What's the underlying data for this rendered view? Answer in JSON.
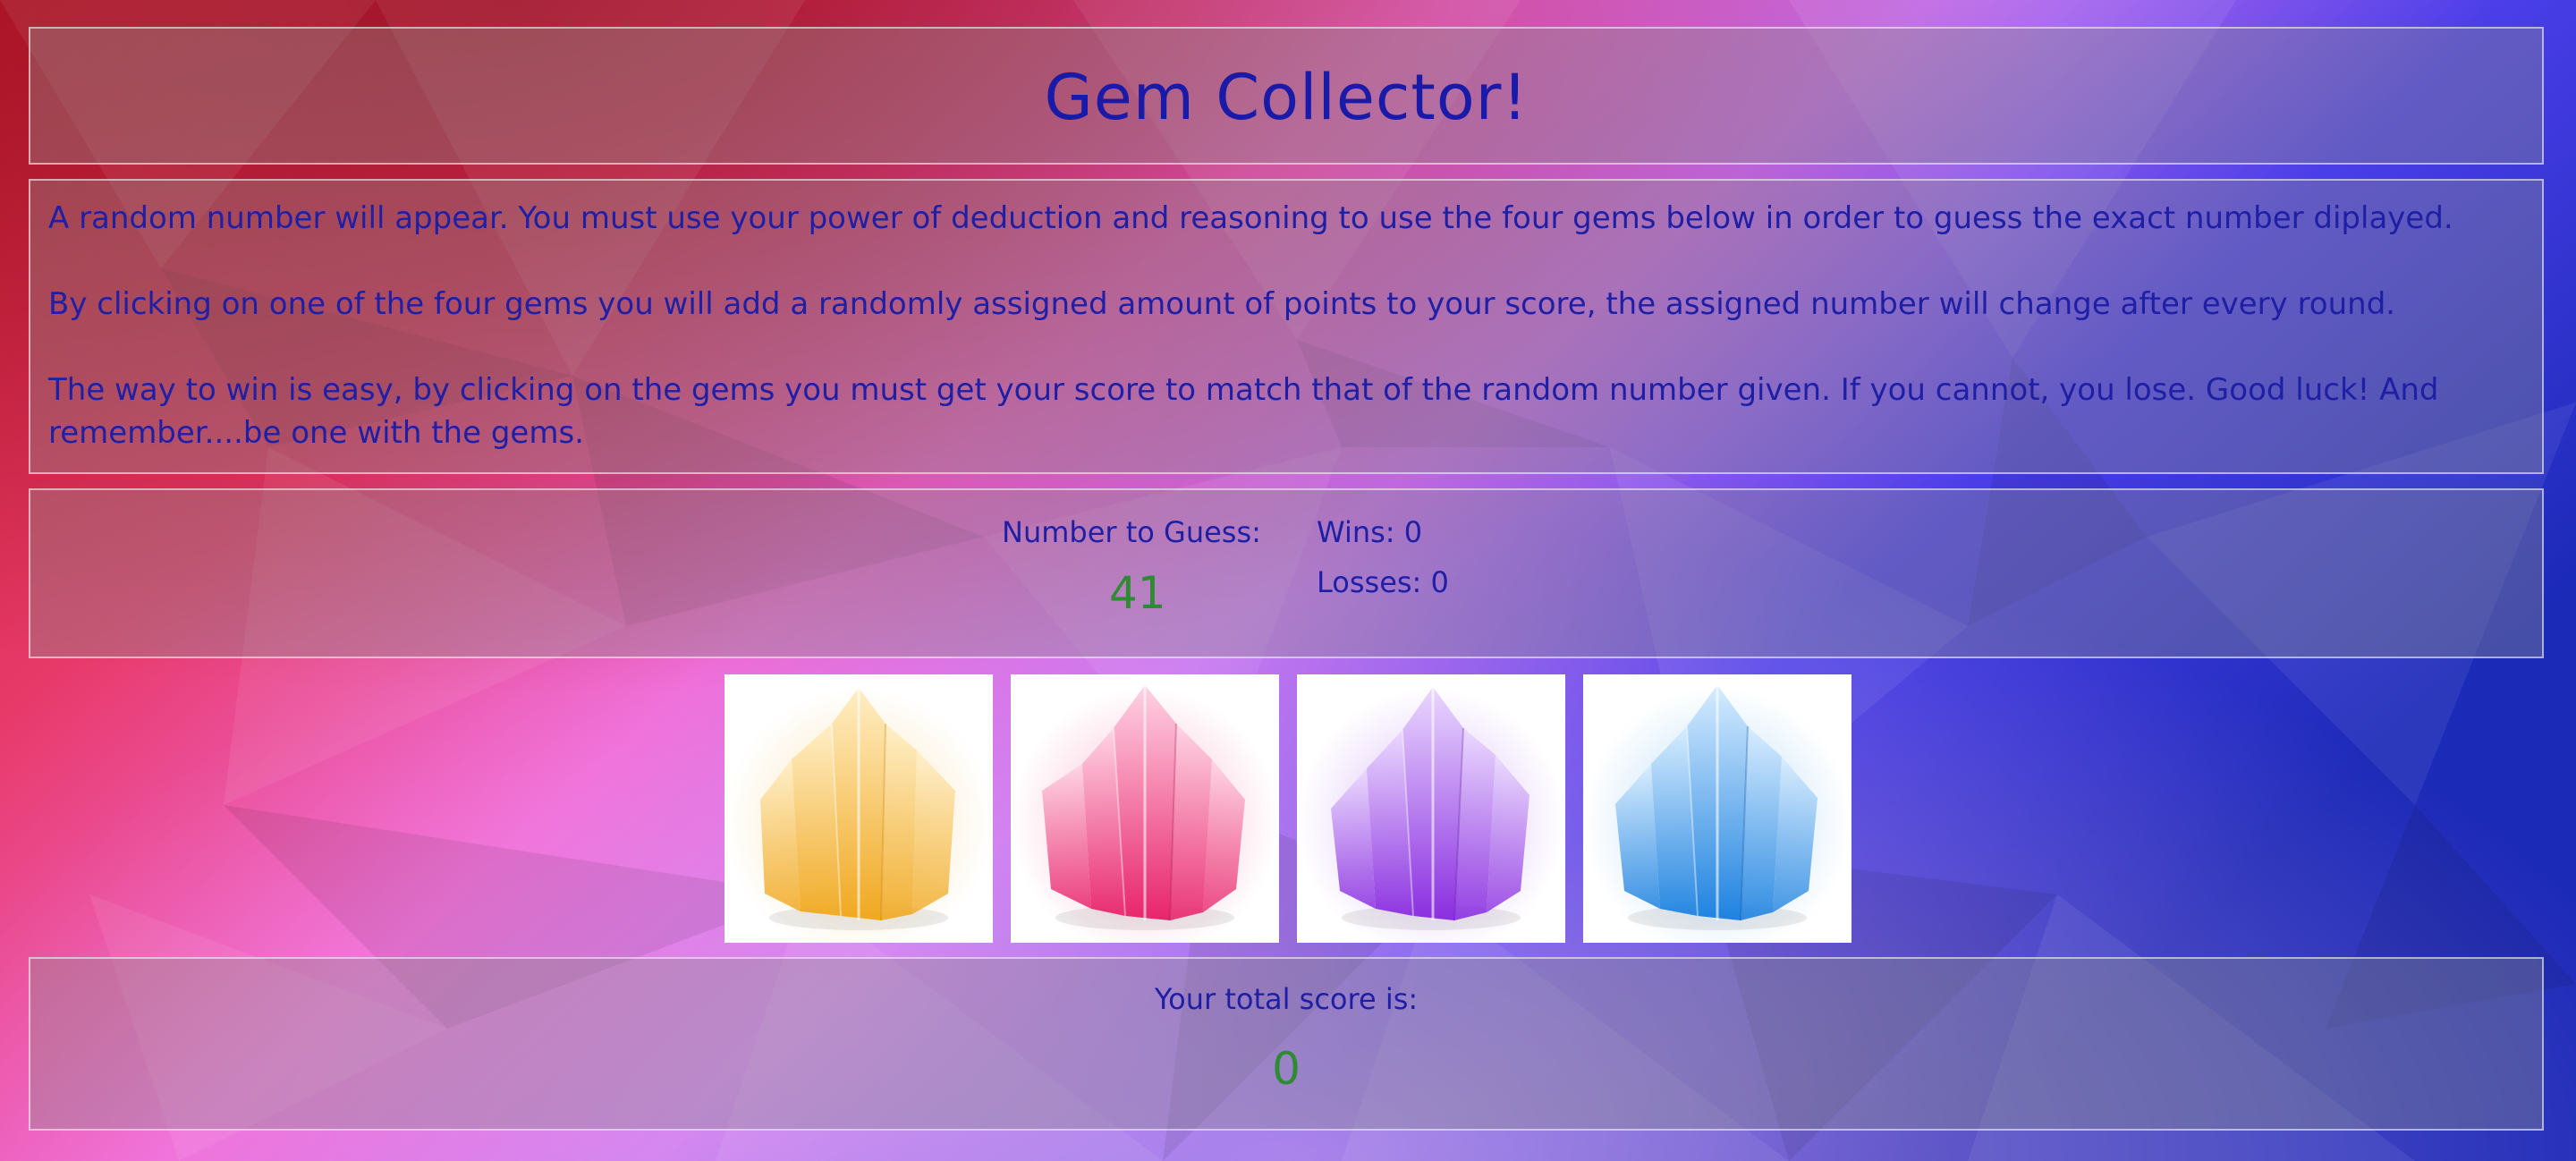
{
  "title": "Gem Collector!",
  "instructions": [
    "A random number will appear. You must use your power of deduction and reasoning to use the four gems below in order to guess the exact number diplayed.",
    "By clicking on one of the four gems you will add a randomly assigned amount of points to your score, the assigned number will change after every round.",
    "The way to win is easy, by clicking on the gems you must get your score to match that of the random number given. If you cannot, you lose. Good luck! And remember....be one with the gems."
  ],
  "stats": {
    "number_to_guess_label": "Number to Guess:",
    "number_to_guess": "41",
    "wins_label": "Wins: 0",
    "losses_label": "Losses: 0"
  },
  "gems": [
    {
      "name": "yellow",
      "color": "#f5b63a"
    },
    {
      "name": "pink",
      "color": "#f0407e"
    },
    {
      "name": "purple",
      "color": "#9b45e8"
    },
    {
      "name": "blue",
      "color": "#3a9ae8"
    }
  ],
  "score": {
    "label": "Your total score is:",
    "value": "0"
  },
  "colors": {
    "text": "#1a1aa8",
    "number": "#2e8b32"
  }
}
